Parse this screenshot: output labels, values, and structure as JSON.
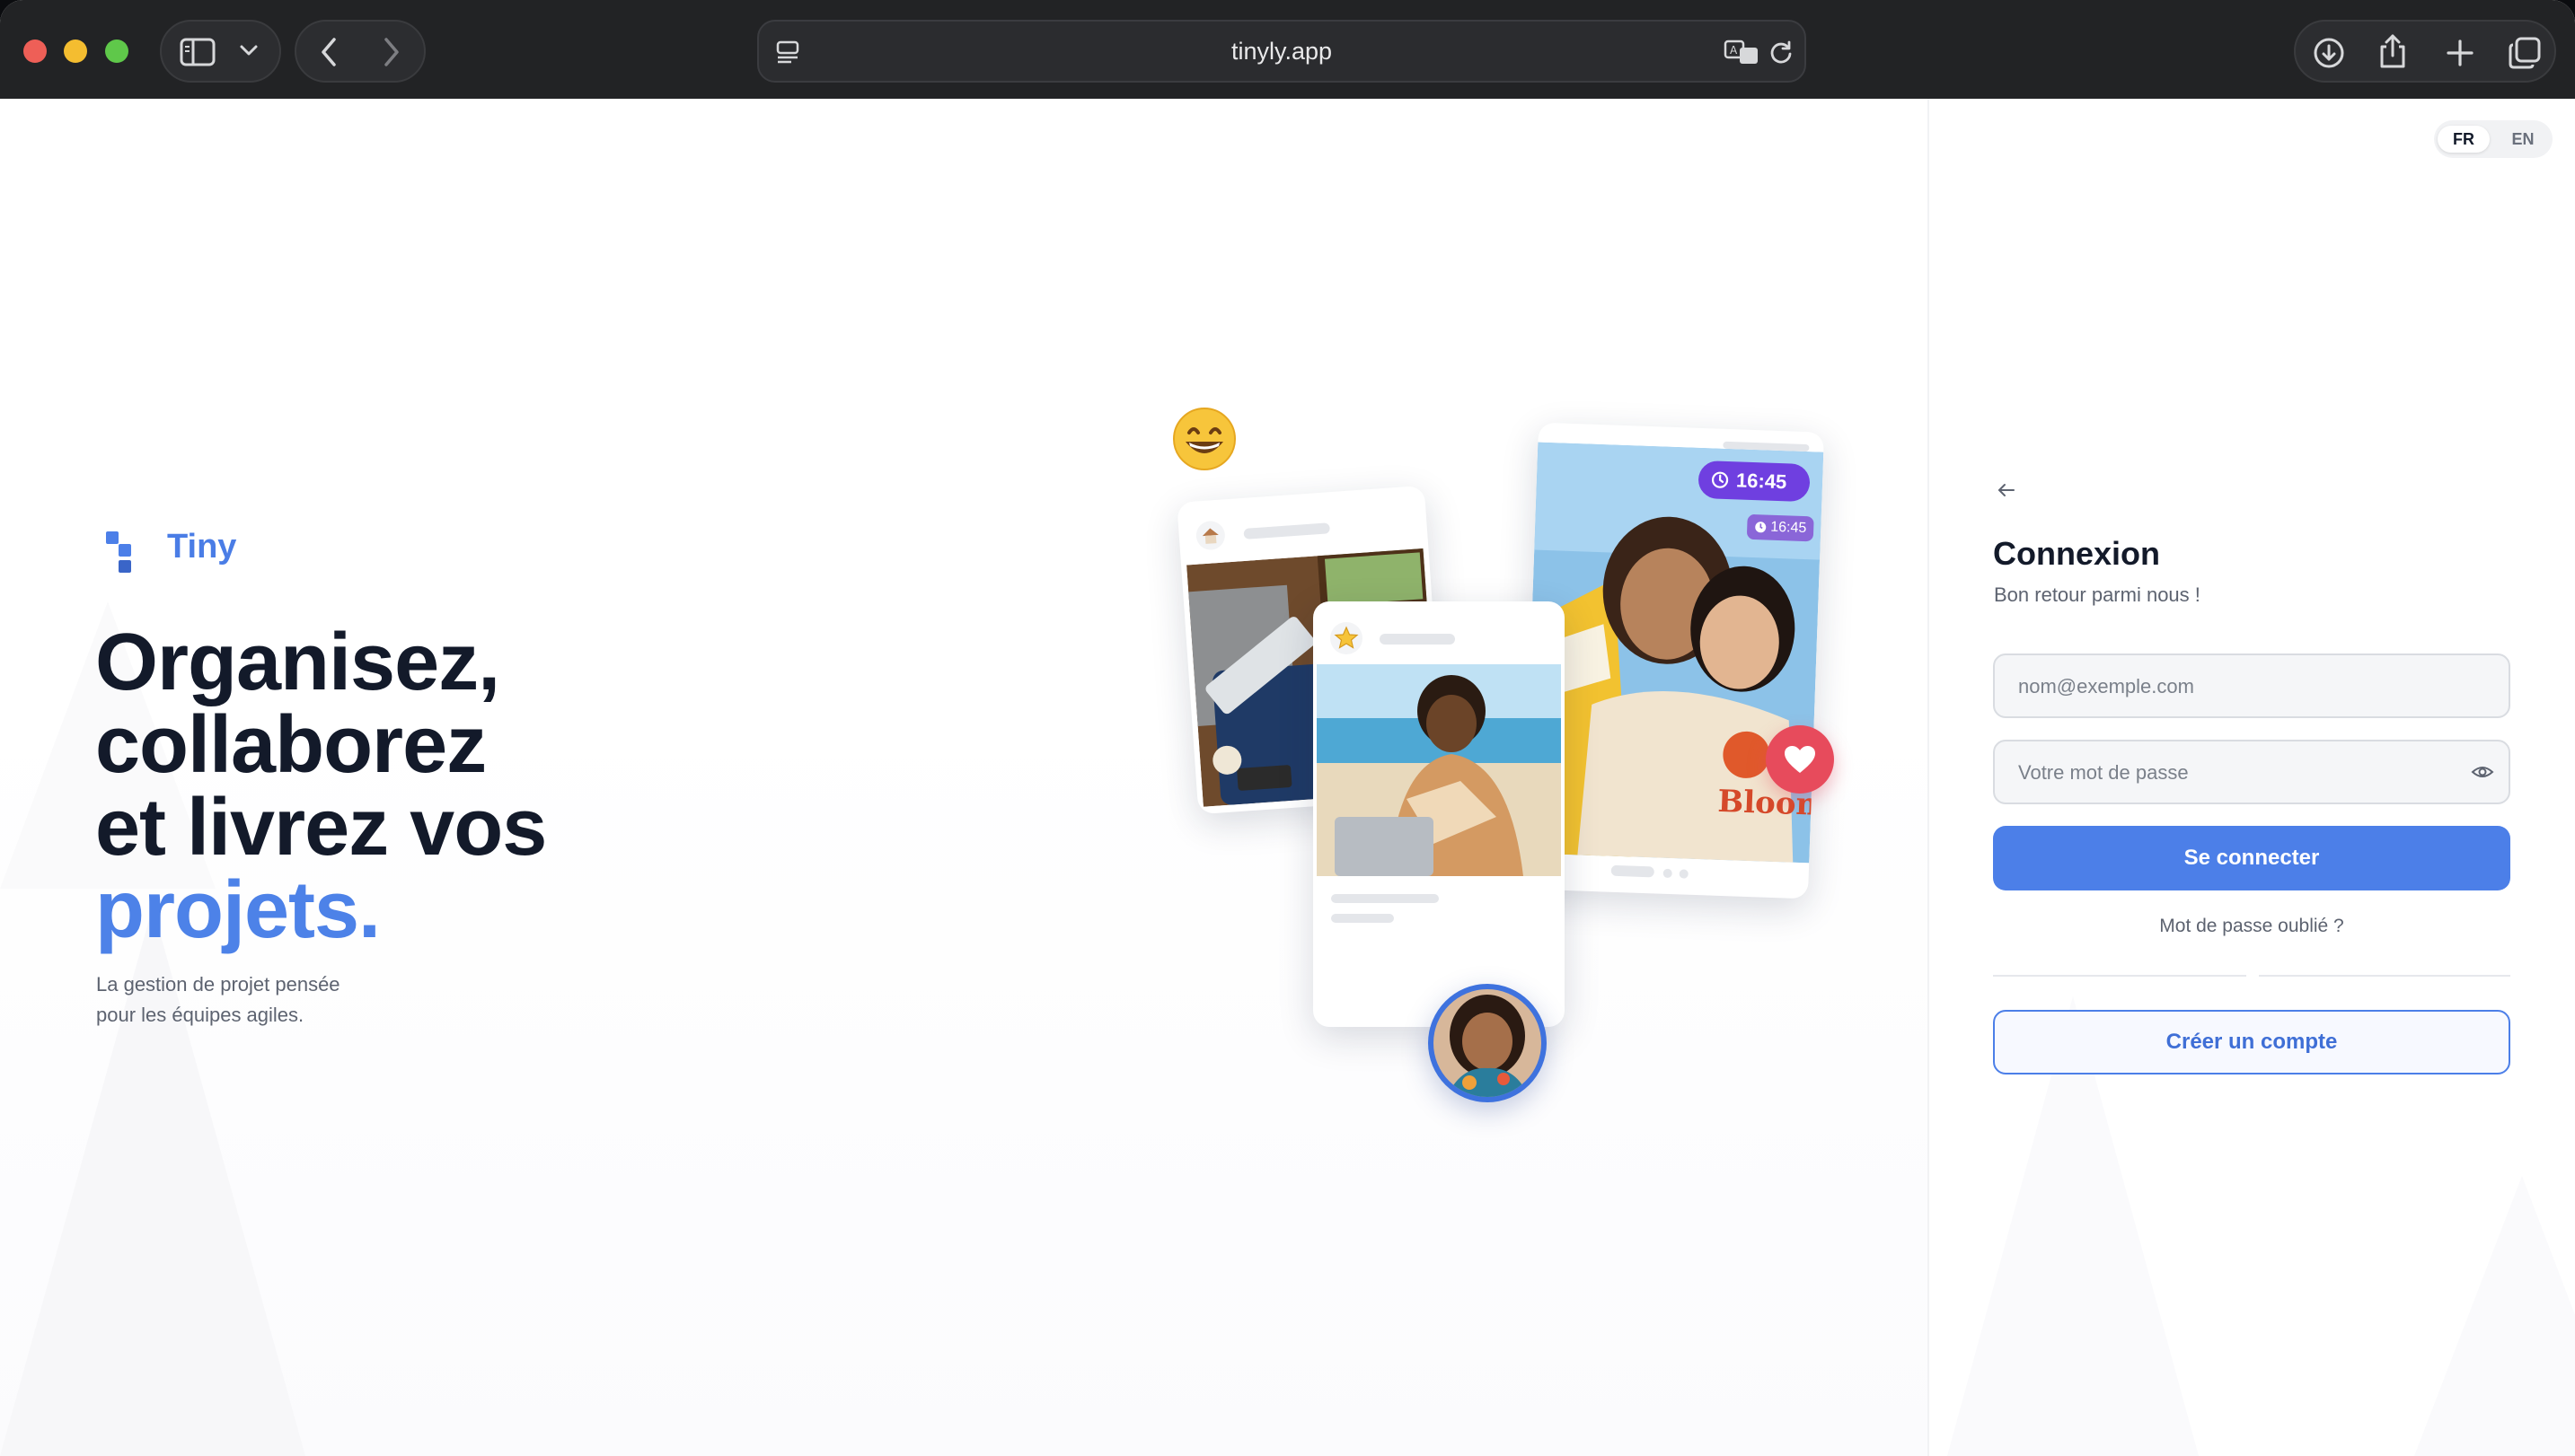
{
  "browser": {
    "url": "tinyly.app"
  },
  "language_switch": {
    "options": [
      "FR",
      "EN"
    ],
    "selected": "FR"
  },
  "brand": {
    "name": "Tiny",
    "accent_color": "#4c7fe8"
  },
  "hero": {
    "headline_line1": "Organisez,",
    "headline_line2": "collaborez",
    "headline_line3": "et livrez vos",
    "headline_accent": "projets.",
    "subline_line1": "La gestion de projet pensée",
    "subline_line2": "pour les équipes agiles."
  },
  "illustration": {
    "time_badge": "16:45",
    "time_badge_small": "16:45",
    "shirt_text": "Bloom"
  },
  "login": {
    "title": "Connexion",
    "subtitle": "Bon retour parmi nous !",
    "email_placeholder": "nom@exemple.com",
    "password_placeholder": "Votre mot de passe",
    "submit_label": "Se connecter",
    "forgot_label": "Mot de passe oublié ?",
    "create_label": "Créer un compte"
  }
}
